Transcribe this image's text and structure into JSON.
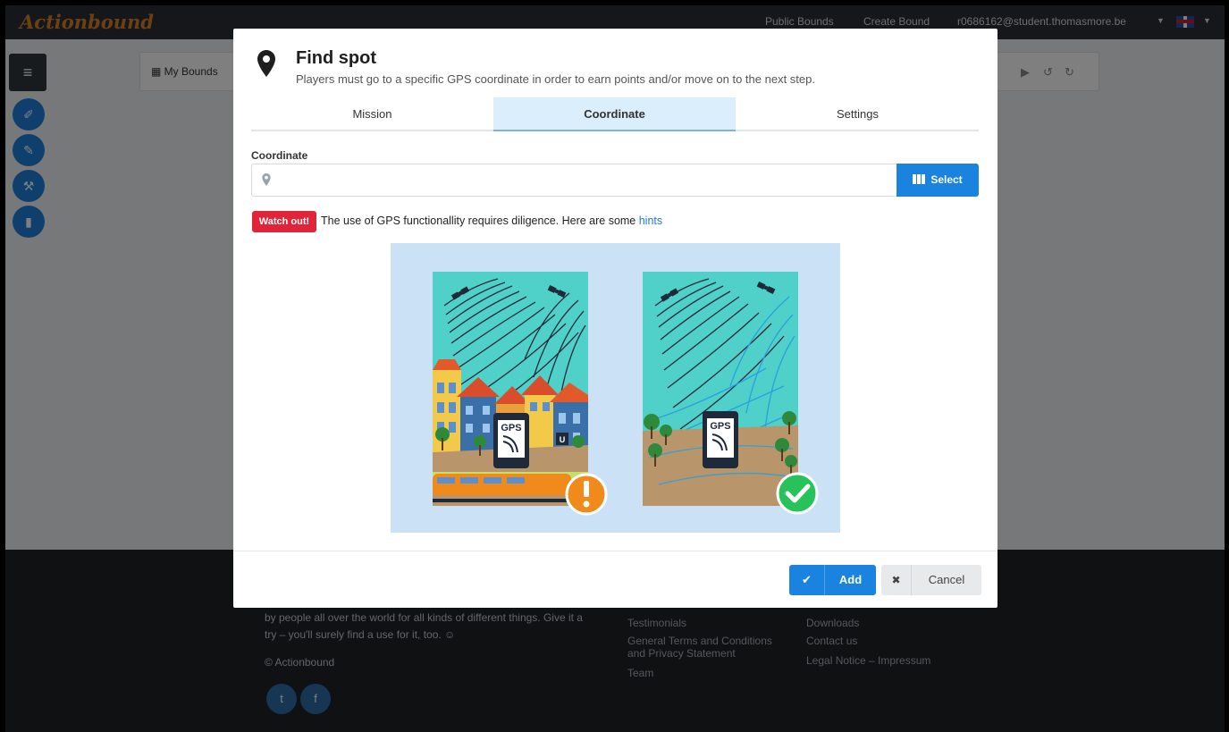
{
  "app": {
    "logo": "Actionbound",
    "nav": {
      "public_bounds": "Public Bounds",
      "create_bound": "Create Bound",
      "user_email": "r0686162@student.thomasmore.be"
    },
    "toolbar": {
      "my_bounds": "My Bounds"
    }
  },
  "footer": {
    "tagline_line1": "by people all over the world for all kinds of different things. Give it a",
    "tagline_line2": "try – you'll surely find a use for it, too. ☺",
    "copyright": "© Actionbound",
    "col2": [
      "Testimonials",
      "General Terms and Conditions",
      "and Privacy Statement",
      "Team"
    ],
    "col3": [
      "Downloads",
      "Contact us",
      "Legal Notice – Impressum"
    ]
  },
  "modal": {
    "title": "Find spot",
    "subtitle": "Players must go to a specific GPS coordinate in order to earn points and/or move on to the next step.",
    "tabs": [
      {
        "label": "Mission",
        "active": false
      },
      {
        "label": "Coordinate",
        "active": true
      },
      {
        "label": "Settings",
        "active": false
      }
    ],
    "coordinate_label": "Coordinate",
    "coordinate_value": "",
    "select_label": "Select",
    "warning_badge": "Watch out!",
    "warning_text": "The use of GPS functionallity requires diligence. Here are some ",
    "hints_link": "hints",
    "illustration": {
      "left_phone_label": "GPS",
      "right_phone_label": "GPS",
      "station_sign": "U"
    },
    "add_label": "Add",
    "cancel_label": "Cancel"
  },
  "colors": {
    "primary": "#1a83e0",
    "danger": "#e0243a",
    "warning": "#f07d12",
    "success": "#27c25a",
    "tab_active": "#dbeefb"
  }
}
